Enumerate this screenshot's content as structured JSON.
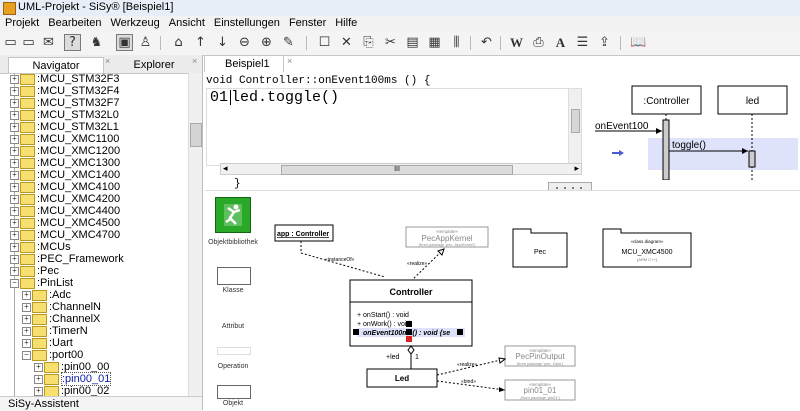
{
  "window": {
    "title": "UML-Projekt - SiSy® [Beispiel1]"
  },
  "menu": [
    "Projekt",
    "Bearbeiten",
    "Werkzeug",
    "Ansicht",
    "Einstellungen",
    "Fenster",
    "Hilfe"
  ],
  "toolbar": {
    "icons": [
      "new-icon",
      "open-icon",
      "mail-icon",
      "help-icon",
      "find-icon",
      "window-icon",
      "user-icon",
      "home-icon",
      "up-icon",
      "down-icon",
      "zoom-out-icon",
      "zoom-in-icon",
      "edit-icon",
      "page-icon",
      "cut-icon",
      "copy-icon",
      "paste-icon",
      "table-icon",
      "grid-icon",
      "undo-icon",
      "bold-icon",
      "print-icon",
      "font-icon",
      "list-icon",
      "export-icon",
      "book-icon"
    ]
  },
  "left_panel": {
    "tabs": [
      "Navigator",
      "Explorer"
    ],
    "close_glyph": "×",
    "tree": [
      {
        "label": ":MCU_STM32F3",
        "level": 0
      },
      {
        "label": ":MCU_STM32F4",
        "level": 0
      },
      {
        "label": ":MCU_STM32F7",
        "level": 0
      },
      {
        "label": ":MCU_STM32L0",
        "level": 0
      },
      {
        "label": ":MCU_STM32L1",
        "level": 0
      },
      {
        "label": ":MCU_XMC1100",
        "level": 0
      },
      {
        "label": ":MCU_XMC1200",
        "level": 0
      },
      {
        "label": ":MCU_XMC1300",
        "level": 0
      },
      {
        "label": ":MCU_XMC1400",
        "level": 0
      },
      {
        "label": ":MCU_XMC4100",
        "level": 0
      },
      {
        "label": ":MCU_XMC4200",
        "level": 0
      },
      {
        "label": ":MCU_XMC4400",
        "level": 0
      },
      {
        "label": ":MCU_XMC4500",
        "level": 0
      },
      {
        "label": ":MCU_XMC4700",
        "level": 0
      },
      {
        "label": ":MCUs",
        "level": 0
      },
      {
        "label": ":PEC_Framework",
        "level": 0
      },
      {
        "label": ":Pec",
        "level": 0
      },
      {
        "label": ":PinList",
        "level": 0,
        "expanded": true
      },
      {
        "label": ":Adc",
        "level": 1
      },
      {
        "label": ":ChannelN",
        "level": 1
      },
      {
        "label": ":ChannelX",
        "level": 1
      },
      {
        "label": ":TimerN",
        "level": 1
      },
      {
        "label": ":Uart",
        "level": 1
      },
      {
        "label": ":port00",
        "level": 1,
        "expanded": true
      },
      {
        "label": ":pin00_00",
        "level": 2
      },
      {
        "label": ":pin00_01",
        "level": 2,
        "selected": true
      },
      {
        "label": ":pin00_02",
        "level": 2
      }
    ],
    "assistant": "SiSy-Assistent"
  },
  "editor": {
    "tab": "Beispiel1",
    "signature": "void Controller::onEvent100ms () {",
    "line_number": "01",
    "line_code": "led.toggle()",
    "closing": "}",
    "scroll_glyph": "III"
  },
  "sequence": {
    "lifeline1": ":Controller",
    "lifeline2": "led",
    "message1": "onEvent100",
    "message2": "toggle()"
  },
  "palette": [
    "Objektbibliothek",
    "Klasse",
    "Attribut",
    "Operation",
    "Objekt"
  ],
  "diagram": {
    "app_label": "app : Controller",
    "pecappkernel_stereo": "«template»",
    "pecappkernel_name": "PecAppKernel",
    "pecappkernel_pkg": "{from package 'pec_AppKernel'}",
    "instanceof": "«instanceOf»",
    "realize1": "«realize»",
    "pec_label": "Pec",
    "mcu_stereo": "«class diagram»",
    "mcu_label": "MCU_XMC4500",
    "mcu_sub": "{ARM C++}",
    "controller_name": "Controller",
    "controller_ops": [
      "+ onStart() : void",
      "+ onWork() : void"
    ],
    "controller_selected_op": "onEvent100ms() : void {se",
    "assoc_role": "+led",
    "assoc_mult": "1",
    "led_name": "Led",
    "pecpin_stereo": "«template»",
    "pecpin_name": "PecPinOutput",
    "pecpin_pkg": "{from package 'pec_Gpio'}",
    "pin01_stereo": "«template»",
    "pin01_name": "pin01_01",
    "pin01_pkg": "{from package 'pin01'}",
    "realize2": "«realize»",
    "bind": "«bind»"
  }
}
